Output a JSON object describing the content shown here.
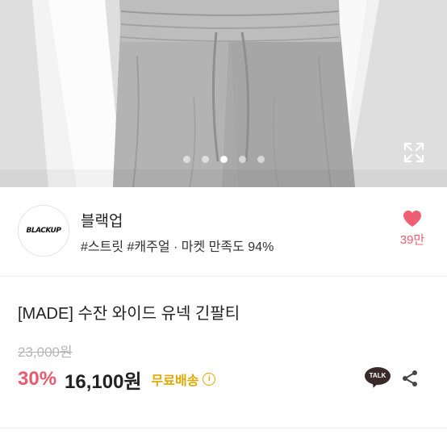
{
  "hero": {
    "image_icon": "product-photo",
    "carousel": {
      "count": 5,
      "active_index": 2
    },
    "expand_icon": "expand-icon"
  },
  "store": {
    "logo_text": "BLACKUP",
    "name": "블랙업",
    "tags": "#스트릿 #캐주얼 · 마켓 만족도 94%",
    "like_icon": "heart-icon",
    "like_color": "#ef5e74",
    "like_count": "39만"
  },
  "product": {
    "title": "[MADE] 수잔 와이드 유넥 긴팔티",
    "original_price": "23,000원",
    "discount": "30%",
    "price": "16,100원",
    "shipping": "무료배송",
    "shipping_info_icon": "info-icon",
    "accent_color": "#e85a6e",
    "shipping_color": "#e0a800"
  },
  "actions": {
    "talk_label": "TALK",
    "talk_icon": "kakaotalk-icon",
    "share_icon": "share-icon"
  }
}
